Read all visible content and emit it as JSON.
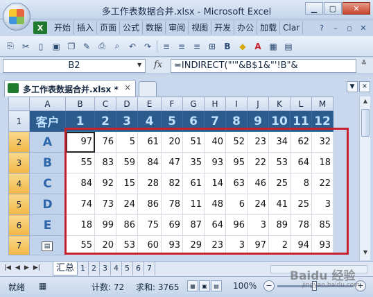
{
  "window": {
    "title": "多工作表数据合并.xlsx - Microsoft Excel"
  },
  "ribbon": {
    "tabs": [
      "开始",
      "插入",
      "页面",
      "公式",
      "数据",
      "审阅",
      "视图",
      "开发",
      "办公",
      "加载",
      "Clar"
    ]
  },
  "formula_bar": {
    "name_box": "B2",
    "fx_label": "fx",
    "formula": "=INDIRECT(\"'\"&B$1&\"'!B\"&"
  },
  "workbook": {
    "tab_name": "多工作表数据合并.xlsx *",
    "close": "×"
  },
  "grid": {
    "col_headers": [
      "A",
      "B",
      "C",
      "D",
      "E",
      "F",
      "G",
      "H",
      "I",
      "J",
      "K",
      "L",
      "M"
    ],
    "row_headers": [
      "1",
      "2",
      "3",
      "4",
      "5",
      "6",
      "7"
    ],
    "header_row": [
      "客户",
      "1",
      "2",
      "3",
      "4",
      "5",
      "6",
      "7",
      "8",
      "9",
      "10",
      "11",
      "12"
    ],
    "rows": [
      {
        "label": "A",
        "values": [
          "97",
          "76",
          "5",
          "61",
          "20",
          "51",
          "40",
          "52",
          "23",
          "34",
          "62",
          "32"
        ]
      },
      {
        "label": "B",
        "values": [
          "55",
          "83",
          "59",
          "84",
          "47",
          "35",
          "93",
          "95",
          "22",
          "53",
          "64",
          "18"
        ]
      },
      {
        "label": "C",
        "values": [
          "84",
          "92",
          "15",
          "28",
          "82",
          "61",
          "14",
          "63",
          "46",
          "25",
          "8",
          "22"
        ]
      },
      {
        "label": "D",
        "values": [
          "74",
          "73",
          "24",
          "86",
          "78",
          "11",
          "48",
          "6",
          "24",
          "41",
          "25",
          "3"
        ]
      },
      {
        "label": "E",
        "values": [
          "18",
          "99",
          "86",
          "75",
          "69",
          "87",
          "64",
          "96",
          "3",
          "89",
          "78",
          "85"
        ]
      },
      {
        "label": "",
        "values": [
          "55",
          "20",
          "53",
          "60",
          "93",
          "29",
          "23",
          "3",
          "97",
          "2",
          "94",
          "93"
        ]
      }
    ]
  },
  "sheets": {
    "tabs": [
      "汇总",
      "1",
      "2",
      "3",
      "4",
      "5",
      "6",
      "7"
    ]
  },
  "status": {
    "ready": "就绪",
    "count": "计数: 72",
    "sum": "求和: 3765",
    "zoom": "100%"
  },
  "watermark": {
    "main": "Baidu 经验",
    "sub": "jingyan.baidu.com"
  },
  "colors": {
    "header_row_bg": "#2c5c8e",
    "customer_col_bg": "#c1d3ea",
    "highlight_border": "#c8202c"
  }
}
